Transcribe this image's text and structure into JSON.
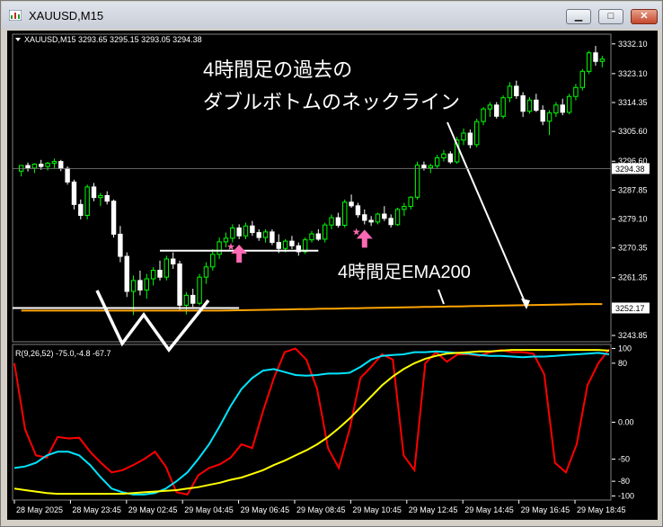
{
  "window": {
    "title": "XAUUSD,M15",
    "buttons": [
      "minimize",
      "maximize",
      "close"
    ],
    "minimize_glyph": "▁",
    "maximize_glyph": "□",
    "close_glyph": "✕"
  },
  "chart_header": {
    "symbol": "XAUUSD,M15",
    "ohlc": "3293.65 3295.15 3293.05 3294.38"
  },
  "indicator_header": "R(9,26,52) -75.0,-4.8 -67.7",
  "annotations": {
    "line1": "4時間足の過去の",
    "line2": "ダブルボトムのネックライン",
    "ema_label": "4時間足EMA200"
  },
  "colors": {
    "bull": "#00ff00",
    "bear": "#ffffff",
    "ema": "#ffa500",
    "red_line": "#ff0000",
    "cyan_line": "#00e5ff",
    "yellow_line": "#ffff00",
    "arrow": "#ff69b4",
    "background": "#000000"
  },
  "chart_data": [
    {
      "type": "candlestick",
      "price_ticks": [
        "3332.10",
        "3323.10",
        "3314.35",
        "3305.60",
        "3296.60",
        "3287.85",
        "3279.10",
        "3270.35",
        "3261.35",
        "3252.60",
        "3243.85"
      ],
      "price_tick_values": [
        3332.1,
        3323.1,
        3314.35,
        3305.6,
        3296.6,
        3287.85,
        3279.1,
        3270.35,
        3261.35,
        3252.6,
        3243.85
      ],
      "ylim": [
        3242.5,
        3334.5
      ],
      "current_price": "3294.38",
      "ema_price": "3252.17",
      "ema_value": 3252.17,
      "time_labels": [
        "28 May 2025",
        "28 May 23:45",
        "29 May 02:45",
        "29 May 04:45",
        "29 May 06:45",
        "29 May 08:45",
        "29 May 10:45",
        "29 May 12:45",
        "29 May 14:45",
        "29 May 16:45",
        "29 May 18:45"
      ],
      "neckline_value": 3269.5,
      "candles": [
        [
          3293.6,
          3295.2,
          3292.0,
          3295.3
        ],
        [
          3295.3,
          3296.2,
          3293.5,
          3294.5
        ],
        [
          3294.5,
          3296.0,
          3293.0,
          3295.7
        ],
        [
          3295.7,
          3297.0,
          3294.0,
          3295.0
        ],
        [
          3295.0,
          3296.4,
          3293.8,
          3296.0
        ],
        [
          3296.0,
          3297.4,
          3294.5,
          3296.5
        ],
        [
          3296.5,
          3297.0,
          3293.6,
          3294.4
        ],
        [
          3294.4,
          3295.0,
          3289.5,
          3290.3
        ],
        [
          3290.3,
          3291.0,
          3282.0,
          3283.5
        ],
        [
          3283.5,
          3285.0,
          3279.0,
          3280.2
        ],
        [
          3280.2,
          3289.5,
          3279.0,
          3288.8
        ],
        [
          3288.8,
          3290.0,
          3284.5,
          3285.6
        ],
        [
          3285.6,
          3287.0,
          3283.0,
          3286.2
        ],
        [
          3286.2,
          3287.5,
          3283.5,
          3284.5
        ],
        [
          3284.5,
          3285.0,
          3273.5,
          3274.5
        ],
        [
          3274.5,
          3277.0,
          3266.0,
          3267.8
        ],
        [
          3267.8,
          3269.0,
          3255.5,
          3257.2
        ],
        [
          3257.2,
          3262.0,
          3250.0,
          3260.5
        ],
        [
          3260.5,
          3263.5,
          3256.0,
          3257.6
        ],
        [
          3257.6,
          3262.5,
          3255.0,
          3261.0
        ],
        [
          3261.0,
          3264.5,
          3259.0,
          3263.6
        ],
        [
          3263.6,
          3266.5,
          3260.5,
          3261.5
        ],
        [
          3261.5,
          3268.0,
          3260.5,
          3267.0
        ],
        [
          3267.0,
          3269.0,
          3264.0,
          3265.5
        ],
        [
          3265.5,
          3266.5,
          3251.5,
          3253.0
        ],
        [
          3253.0,
          3257.0,
          3250.2,
          3256.0
        ],
        [
          3256.0,
          3258.0,
          3252.5,
          3253.6
        ],
        [
          3253.6,
          3262.5,
          3253.0,
          3261.5
        ],
        [
          3261.5,
          3266.0,
          3259.5,
          3264.6
        ],
        [
          3264.6,
          3270.0,
          3263.5,
          3268.4
        ],
        [
          3268.4,
          3273.5,
          3267.0,
          3272.2
        ],
        [
          3272.2,
          3275.0,
          3270.5,
          3273.3
        ],
        [
          3273.3,
          3277.5,
          3272.0,
          3276.4
        ],
        [
          3276.4,
          3277.5,
          3273.0,
          3274.0
        ],
        [
          3274.0,
          3278.0,
          3273.0,
          3277.0
        ],
        [
          3277.0,
          3278.5,
          3274.0,
          3275.0
        ],
        [
          3275.0,
          3276.0,
          3272.5,
          3273.5
        ],
        [
          3273.5,
          3276.0,
          3272.0,
          3275.2
        ],
        [
          3275.2,
          3276.0,
          3271.2,
          3272.0
        ],
        [
          3272.0,
          3274.5,
          3268.8,
          3270.2
        ],
        [
          3270.2,
          3273.0,
          3269.0,
          3272.4
        ],
        [
          3272.4,
          3274.0,
          3270.0,
          3271.0
        ],
        [
          3271.0,
          3272.0,
          3268.0,
          3269.2
        ],
        [
          3269.2,
          3273.5,
          3268.5,
          3272.8
        ],
        [
          3272.8,
          3275.5,
          3272.0,
          3274.6
        ],
        [
          3274.6,
          3276.0,
          3272.5,
          3273.0
        ],
        [
          3273.0,
          3278.0,
          3272.0,
          3277.3
        ],
        [
          3277.3,
          3280.5,
          3276.0,
          3279.5
        ],
        [
          3279.5,
          3281.0,
          3276.5,
          3277.2
        ],
        [
          3277.2,
          3285.0,
          3276.5,
          3284.2
        ],
        [
          3284.2,
          3286.5,
          3282.5,
          3283.1
        ],
        [
          3283.1,
          3284.0,
          3279.5,
          3280.4
        ],
        [
          3280.4,
          3282.0,
          3277.5,
          3278.7
        ],
        [
          3278.7,
          3280.0,
          3277.0,
          3278.2
        ],
        [
          3278.2,
          3281.0,
          3277.5,
          3280.6
        ],
        [
          3280.6,
          3283.0,
          3278.5,
          3279.3
        ],
        [
          3279.3,
          3280.5,
          3276.5,
          3277.4
        ],
        [
          3277.4,
          3282.5,
          3277.0,
          3282.0
        ],
        [
          3282.0,
          3284.0,
          3280.0,
          3282.9
        ],
        [
          3282.9,
          3286.0,
          3282.0,
          3285.7
        ],
        [
          3285.7,
          3296.5,
          3285.0,
          3295.4
        ],
        [
          3295.4,
          3296.5,
          3293.8,
          3294.6
        ],
        [
          3294.6,
          3295.8,
          3293.0,
          3295.2
        ],
        [
          3295.2,
          3298.5,
          3294.5,
          3297.6
        ],
        [
          3297.6,
          3300.0,
          3296.5,
          3298.8
        ],
        [
          3298.8,
          3299.6,
          3295.8,
          3296.4
        ],
        [
          3296.4,
          3304.0,
          3295.8,
          3303.0
        ],
        [
          3303.0,
          3306.5,
          3301.5,
          3305.1
        ],
        [
          3305.1,
          3306.2,
          3300.5,
          3301.6
        ],
        [
          3301.6,
          3309.5,
          3300.8,
          3308.6
        ],
        [
          3308.6,
          3313.0,
          3307.5,
          3312.4
        ],
        [
          3312.4,
          3314.5,
          3310.0,
          3313.6
        ],
        [
          3313.6,
          3314.5,
          3309.5,
          3310.2
        ],
        [
          3310.2,
          3316.5,
          3309.5,
          3315.8
        ],
        [
          3315.8,
          3320.5,
          3314.5,
          3319.3
        ],
        [
          3319.3,
          3321.0,
          3315.5,
          3316.4
        ],
        [
          3316.4,
          3317.5,
          3310.0,
          3311.7
        ],
        [
          3311.7,
          3316.0,
          3311.0,
          3315.1
        ],
        [
          3315.1,
          3317.0,
          3311.5,
          3312.0
        ],
        [
          3312.0,
          3313.5,
          3307.5,
          3308.7
        ],
        [
          3308.7,
          3312.0,
          3304.5,
          3311.2
        ],
        [
          3311.2,
          3314.5,
          3310.0,
          3313.6
        ],
        [
          3313.6,
          3315.5,
          3310.5,
          3311.4
        ],
        [
          3311.4,
          3317.0,
          3310.8,
          3316.2
        ],
        [
          3316.2,
          3320.0,
          3315.0,
          3318.9
        ],
        [
          3318.9,
          3324.5,
          3318.0,
          3323.8
        ],
        [
          3323.8,
          3330.0,
          3323.0,
          3329.4
        ],
        [
          3329.4,
          3331.5,
          3325.5,
          3326.8
        ],
        [
          3326.8,
          3328.5,
          3325.0,
          3327.5
        ]
      ],
      "arrows_up_at_index": [
        33,
        52
      ]
    },
    {
      "type": "line",
      "name": "R(9,26,52)",
      "yticks": [
        "100",
        "80",
        "0.00",
        "-50",
        "-80",
        "-100"
      ],
      "ytick_values": [
        100,
        80,
        0,
        -50,
        -80,
        -100
      ],
      "ylim": [
        -103,
        103
      ],
      "series": [
        {
          "color": "red",
          "values": [
            80,
            -10,
            -45,
            -48,
            -20,
            -22,
            -21,
            -40,
            -55,
            -68,
            -65,
            -58,
            -50,
            -40,
            -60,
            -95,
            -98,
            -72,
            -62,
            -57,
            -48,
            -30,
            -35,
            15,
            60,
            95,
            100,
            85,
            45,
            -35,
            -62,
            -10,
            60,
            75,
            92,
            85,
            -45,
            -65,
            80,
            95,
            82,
            92,
            92,
            90,
            95,
            98,
            95,
            95,
            93,
            65,
            -55,
            -68,
            -30,
            50,
            80,
            99
          ]
        },
        {
          "color": "cyan",
          "values": [
            -62,
            -60,
            -55,
            -45,
            -40,
            -40,
            -45,
            -58,
            -75,
            -90,
            -95,
            -98,
            -98,
            -96,
            -90,
            -80,
            -68,
            -50,
            -30,
            -5,
            22,
            45,
            60,
            70,
            72,
            68,
            64,
            63,
            64,
            66,
            66,
            67,
            75,
            85,
            90,
            91,
            92,
            95,
            95,
            96,
            95,
            94,
            93,
            91,
            90,
            90,
            89,
            88,
            89,
            89,
            90,
            91,
            92,
            93,
            94,
            92
          ]
        },
        {
          "color": "yellow",
          "values": [
            -90,
            -92,
            -94,
            -96,
            -97,
            -97,
            -97,
            -97,
            -97,
            -97,
            -97,
            -96,
            -95,
            -94,
            -93,
            -92,
            -90,
            -88,
            -85,
            -82,
            -78,
            -75,
            -70,
            -65,
            -58,
            -52,
            -45,
            -38,
            -30,
            -20,
            -8,
            5,
            20,
            35,
            50,
            62,
            72,
            80,
            86,
            90,
            93,
            94,
            95,
            96,
            96,
            97,
            98,
            98,
            98,
            98,
            98,
            98,
            98,
            98,
            98,
            97
          ]
        }
      ]
    }
  ]
}
